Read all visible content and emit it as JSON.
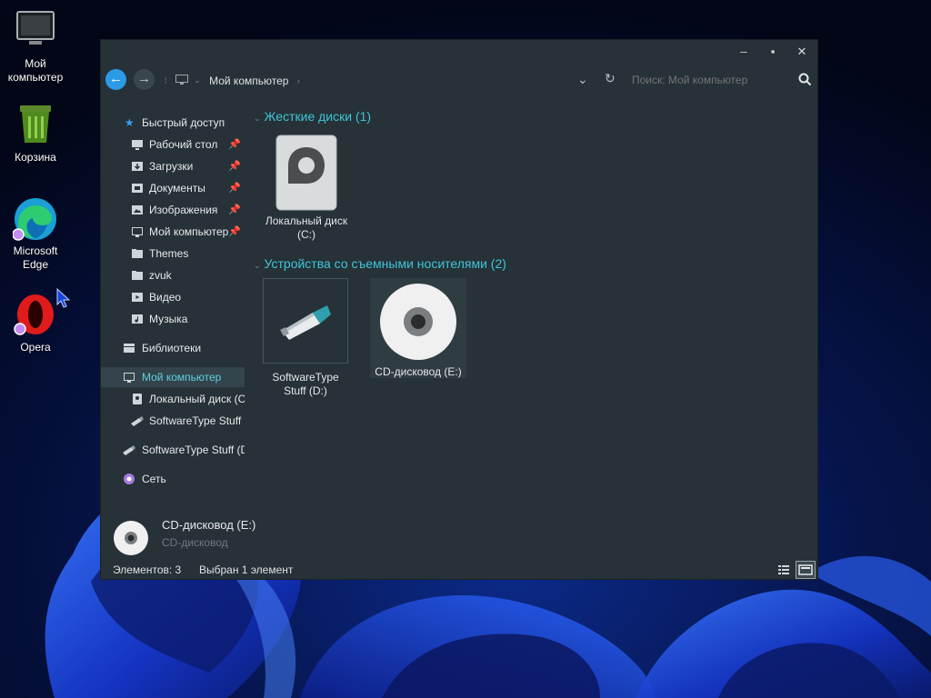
{
  "desktop": {
    "icons": [
      {
        "label": "Мой\nкомпьютер",
        "icon": "computer-icon"
      },
      {
        "label": "Корзина",
        "icon": "recycle-bin-icon"
      },
      {
        "label": "Microsoft\nEdge",
        "icon": "edge-icon"
      },
      {
        "label": "Opera",
        "icon": "opera-icon"
      }
    ],
    "wallpaper_accent": "#1f4fe0"
  },
  "window": {
    "controls": {
      "minimize": "–",
      "maximize": "▪",
      "close": "✕"
    },
    "breadcrumb": {
      "location": "Мой компьютер"
    },
    "search": {
      "placeholder": "Поиск: Мой компьютер"
    },
    "colors": {
      "background": "#263238",
      "accent": "#3ec5d8",
      "selected": "#33444c"
    }
  },
  "sidebar": {
    "quick_access": {
      "label": "Быстрый доступ",
      "icon": "star-icon"
    },
    "quick_items": [
      {
        "label": "Рабочий стол",
        "icon": "desktop-icon",
        "pinned": true
      },
      {
        "label": "Загрузки",
        "icon": "downloads-icon",
        "pinned": true
      },
      {
        "label": "Документы",
        "icon": "documents-icon",
        "pinned": true
      },
      {
        "label": "Изображения",
        "icon": "pictures-icon",
        "pinned": true
      },
      {
        "label": "Мой компьютер",
        "icon": "computer-icon",
        "pinned": true
      },
      {
        "label": "Themes",
        "icon": "folder-icon",
        "pinned": false
      },
      {
        "label": "zvuk",
        "icon": "folder-icon",
        "pinned": false
      },
      {
        "label": "Видео",
        "icon": "video-icon",
        "pinned": false
      },
      {
        "label": "Музыка",
        "icon": "music-icon",
        "pinned": false
      }
    ],
    "libraries": {
      "label": "Библиотеки",
      "icon": "libraries-icon"
    },
    "this_pc": {
      "label": "Мой компьютер",
      "icon": "computer-icon"
    },
    "pc_items": [
      {
        "label": "Локальный диск (C:)",
        "icon": "hard-drive-icon"
      },
      {
        "label": "SoftwareType Stuff (D:)",
        "icon": "usb-drive-icon"
      }
    ],
    "usb_root": {
      "label": "SoftwareType Stuff (D:)",
      "icon": "usb-drive-icon"
    },
    "network": {
      "label": "Сеть",
      "icon": "network-icon"
    }
  },
  "content": {
    "groups": [
      {
        "title": "Жесткие диски (1)",
        "items": [
          {
            "label": "Локальный диск\n(C:)",
            "icon": "hard-drive-icon"
          }
        ]
      },
      {
        "title": "Устройства со съемными носителями (2)",
        "items": [
          {
            "label": "SoftwareType\nStuff (D:)",
            "icon": "usb-drive-icon"
          },
          {
            "label": "CD-дисковод (E:)",
            "icon": "cd-drive-icon"
          }
        ]
      }
    ]
  },
  "details": {
    "name": "CD-дисковод (E:)",
    "type": "CD-дисковод"
  },
  "status": {
    "item_count": "Элементов: 3",
    "selection": "Выбран 1 элемент"
  }
}
